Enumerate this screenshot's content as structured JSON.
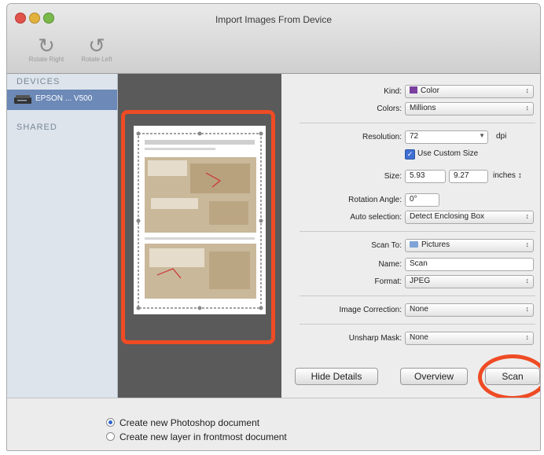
{
  "window": {
    "title": "Import Images From Device"
  },
  "toolbar": {
    "rotate_right_label": "Rotate Right",
    "rotate_left_label": "Rotate Left",
    "rotate_right_icon": "rotate-right-icon",
    "rotate_left_icon": "rotate-left-icon"
  },
  "sidebar": {
    "devices_header": "DEVICES",
    "device_name": "EPSON ... V500",
    "shared_header": "SHARED"
  },
  "settings": {
    "kind": {
      "label": "Kind:",
      "value": "Color"
    },
    "colors": {
      "label": "Colors:",
      "value": "Millions"
    },
    "resolution": {
      "label": "Resolution:",
      "value": "72",
      "unit": "dpi"
    },
    "use_custom_size": {
      "label": "Use Custom Size",
      "checked": true
    },
    "size": {
      "label": "Size:",
      "width": "5.93",
      "height": "9.27",
      "unit": "inches"
    },
    "rotation_angle": {
      "label": "Rotation Angle:",
      "value": "0°"
    },
    "auto_selection": {
      "label": "Auto selection:",
      "value": "Detect Enclosing Box"
    },
    "scan_to": {
      "label": "Scan To:",
      "value": "Pictures"
    },
    "name": {
      "label": "Name:",
      "value": "Scan"
    },
    "format": {
      "label": "Format:",
      "value": "JPEG"
    },
    "image_correction": {
      "label": "Image Correction:",
      "value": "None"
    },
    "unsharp_mask": {
      "label": "Unsharp Mask:",
      "value": "None"
    }
  },
  "buttons": {
    "hide_details": "Hide Details",
    "overview": "Overview",
    "scan": "Scan"
  },
  "options": {
    "new_document": "Create new Photoshop document",
    "new_layer": "Create new layer in frontmost document",
    "selected": "new_document"
  },
  "colors": {
    "highlight": "#ef4b24",
    "selection": "#6c89b7"
  }
}
